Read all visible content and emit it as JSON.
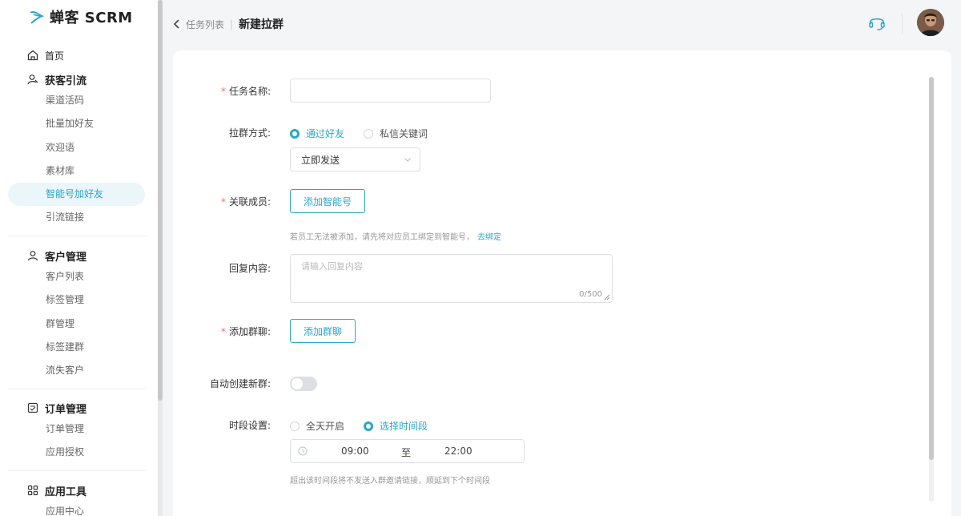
{
  "app": {
    "logo_text": "蝉客 SCRM",
    "accent": "#2aa7c9"
  },
  "sidebar": {
    "home": "首页",
    "groups": [
      {
        "title": "获客引流",
        "icon": "person-search-icon",
        "items": [
          "渠道活码",
          "批量加好友",
          "欢迎语",
          "素材库",
          "智能号加好友",
          "引流链接"
        ],
        "active": "智能号加好友"
      },
      {
        "title": "客户管理",
        "icon": "customer-icon",
        "items": [
          "客户列表",
          "标签管理",
          "群管理",
          "标签建群",
          "流失客户"
        ]
      },
      {
        "title": "订单管理",
        "icon": "order-icon",
        "items": [
          "订单管理",
          "应用授权"
        ]
      },
      {
        "title": "应用工具",
        "icon": "grid-icon",
        "items": [
          "应用中心"
        ]
      }
    ]
  },
  "header": {
    "parent": "任务列表",
    "current": "新建拉群"
  },
  "form": {
    "task_name": {
      "label": "任务名称:",
      "required": true,
      "value": ""
    },
    "method": {
      "label": "拉群方式:",
      "options": [
        "通过好友",
        "私信关键词"
      ],
      "selected": "通过好友",
      "send_mode": "立即发送"
    },
    "members": {
      "label": "关联成员:",
      "required": true,
      "button": "添加智能号",
      "hint": "若员工无法被添加，请先将对应员工绑定到智能号，",
      "hint_link": "去绑定"
    },
    "reply": {
      "label": "回复内容:",
      "placeholder": "请输入回复内容",
      "counter": "0/500"
    },
    "group_chat": {
      "label": "添加群聊:",
      "required": true,
      "button": "添加群聊"
    },
    "auto_create": {
      "label": "自动创建新群:",
      "enabled": false
    },
    "time": {
      "label": "时段设置:",
      "options": [
        "全天开启",
        "选择时间段"
      ],
      "selected": "选择时间段",
      "start": "09:00",
      "separator": "至",
      "end": "22:00",
      "hint": "超出该时间段将不发送入群邀请链接，顺延到下个时间段"
    }
  }
}
